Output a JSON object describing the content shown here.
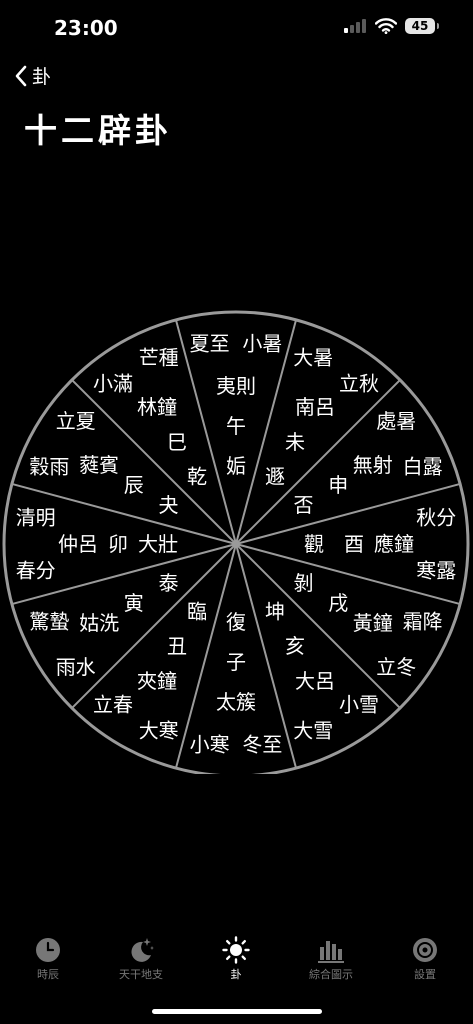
{
  "status_bar": {
    "time": "23:00",
    "battery": "45"
  },
  "nav": {
    "back_label": "卦"
  },
  "page": {
    "title": "十二辟卦"
  },
  "wheel": {
    "sectors": [
      {
        "terms": [
          "夏至",
          "小暑"
        ],
        "lu": "夷則",
        "branch": "午",
        "hexagram": "姤"
      },
      {
        "terms": [
          "大暑",
          "立秋"
        ],
        "lu": "南呂",
        "branch": "未",
        "hexagram": "遯"
      },
      {
        "terms": [
          "處暑",
          "白露"
        ],
        "lu": "無射",
        "branch": "申",
        "hexagram": "否"
      },
      {
        "terms": [
          "秋分",
          "寒露"
        ],
        "lu": "應鐘",
        "branch": "酉",
        "hexagram": "觀"
      },
      {
        "terms": [
          "霜降",
          "立冬"
        ],
        "lu": "黃鐘",
        "branch": "戌",
        "hexagram": "剝"
      },
      {
        "terms": [
          "小雪",
          "大雪"
        ],
        "lu": "大呂",
        "branch": "亥",
        "hexagram": "坤"
      },
      {
        "terms": [
          "冬至",
          "小寒"
        ],
        "lu": "太簇",
        "branch": "子",
        "hexagram": "復"
      },
      {
        "terms": [
          "大寒",
          "立春"
        ],
        "lu": "夾鐘",
        "branch": "丑",
        "hexagram": "臨"
      },
      {
        "terms": [
          "雨水",
          "驚蟄"
        ],
        "lu": "姑洗",
        "branch": "寅",
        "hexagram": "泰"
      },
      {
        "terms": [
          "春分",
          "清明"
        ],
        "lu": "仲呂",
        "branch": "卯",
        "hexagram": "大壯"
      },
      {
        "terms": [
          "穀雨",
          "立夏"
        ],
        "lu": "蕤賓",
        "branch": "辰",
        "hexagram": "夬"
      },
      {
        "terms": [
          "小滿",
          "芒種"
        ],
        "lu": "林鐘",
        "branch": "巳",
        "hexagram": "乾"
      }
    ]
  },
  "tabs": [
    {
      "label": "時辰",
      "icon": "clock-icon",
      "active": false
    },
    {
      "label": "天干地支",
      "icon": "moon-stars-icon",
      "active": false
    },
    {
      "label": "卦",
      "icon": "sun-icon",
      "active": true
    },
    {
      "label": "綜合圖示",
      "icon": "chart-icon",
      "active": false
    },
    {
      "label": "設置",
      "icon": "gear-icon",
      "active": false
    }
  ],
  "colors": {
    "background": "#000000",
    "wheel_line": "#9a9a9a",
    "inactive_tab": "#777777",
    "active_tab": "#ffffff"
  }
}
